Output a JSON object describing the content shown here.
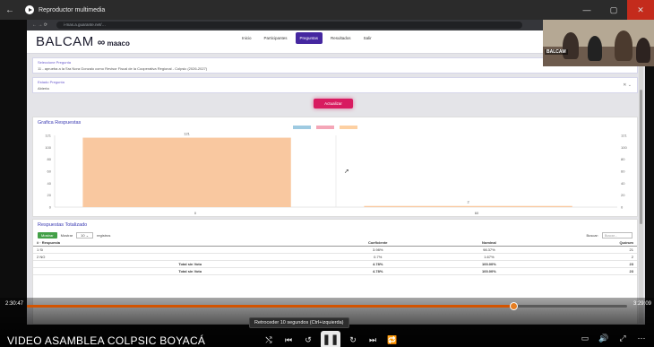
{
  "window": {
    "title": "Reproductor multimedia",
    "back_icon": "back-arrow-icon",
    "controls": [
      "—",
      "▢",
      "✕"
    ]
  },
  "browser": {
    "url": "i-mas.a.guarante.net/…"
  },
  "app": {
    "logo_text": "BALCAM",
    "partner_logo": "maaco",
    "menu": [
      {
        "label": "Inicio",
        "active": false
      },
      {
        "label": "Participantes",
        "active": false
      },
      {
        "label": "Preguntas",
        "active": true
      },
      {
        "label": "Resultados",
        "active": false
      },
      {
        "label": "Salir",
        "active": false
      }
    ],
    "filter1": {
      "label": "Seleccione Pregunta",
      "value": "11 - aprueba a la Sra Nora Gonzalo como Revisor Fiscal de la Cooperativa Regional - Colpsic (2026-2027)"
    },
    "filter2": {
      "label": "Estado Pregunta",
      "value": "Abierta"
    },
    "update_button": "Actualizar"
  },
  "chart_data": {
    "title": "Grafica Respuestas",
    "type": "bar",
    "categories": [
      "Sí",
      "No"
    ],
    "series": [
      {
        "name": "",
        "color": "#f9c8a0",
        "values": [
          121,
          2
        ]
      }
    ],
    "legend_colors": [
      "#9ecae1",
      "#f4a6b7",
      "#fdd0a2"
    ],
    "ylim": [
      0,
      125
    ],
    "yticks": [
      "0",
      "20",
      "40",
      "60",
      "80",
      "100",
      "121"
    ],
    "xlabels": [
      "0",
      "60"
    ],
    "bar_labels": [
      "121",
      "2"
    ]
  },
  "table": {
    "title": "Respuestas Totalizado",
    "show_label": "Mostrar",
    "entries": "10",
    "records_label": "registros",
    "search_label": "Buscar:",
    "search_placeholder": "Buscar…",
    "columns": [
      "# · Respuesta",
      "Coeficiente",
      "Nominal",
      "Quórum"
    ],
    "rows": [
      {
        "id": "1",
        "respuesta": "Sí",
        "coef": "3.98%",
        "nominal": "98.37%",
        "quorum": "21"
      },
      {
        "id": "2",
        "respuesta": "NO",
        "coef": "0.7%",
        "nominal": "1.67%",
        "quorum": "2"
      }
    ],
    "totals": [
      {
        "label": "Total sin Voto",
        "coef": "4.78%",
        "nominal": "100.00%",
        "quorum": "23"
      },
      {
        "label": "Total sin Voto",
        "coef": "4.78%",
        "nominal": "100.00%",
        "quorum": "23"
      }
    ]
  },
  "webcam": {
    "label": "BALCAM"
  },
  "player": {
    "current_time": "2:30:47",
    "total_time": "3:29:09",
    "progress": 0.81,
    "tooltip": "Retroceder 10 segundos (Ctrl+izquierda)",
    "video_title": "VIDEO ASAMBLEA COLPSIC BOYACÁ",
    "controls": [
      {
        "name": "shuffle-icon",
        "glyph": "⤭"
      },
      {
        "name": "previous-icon",
        "glyph": "⏮"
      },
      {
        "name": "rewind-10-icon",
        "glyph": "↺"
      },
      {
        "name": "pause-icon",
        "glyph": "❚❚"
      },
      {
        "name": "forward-30-icon",
        "glyph": "↻"
      },
      {
        "name": "next-icon",
        "glyph": "⏭"
      },
      {
        "name": "repeat-icon",
        "glyph": "🔁"
      }
    ],
    "right_controls": [
      {
        "name": "miniplayer-icon",
        "glyph": "▭"
      },
      {
        "name": "volume-icon",
        "glyph": "🔊"
      },
      {
        "name": "fullscreen-icon",
        "glyph": "⤢"
      },
      {
        "name": "more-icon",
        "glyph": "⋯"
      }
    ]
  }
}
